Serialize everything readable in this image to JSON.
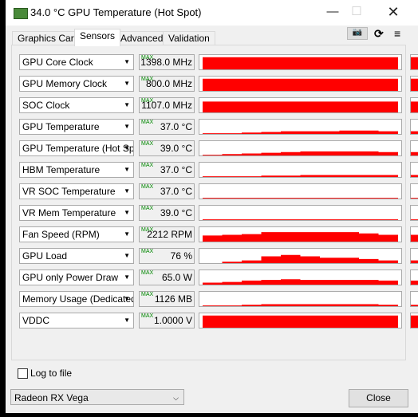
{
  "window": {
    "title": "34.0 °C GPU Temperature (Hot Spot)"
  },
  "tabs": [
    {
      "label": "Graphics Card"
    },
    {
      "label": "Sensors",
      "active": true
    },
    {
      "label": "Advanced"
    },
    {
      "label": "Validation"
    }
  ],
  "toolbar": {
    "icons": [
      "camera-icon",
      "refresh-icon",
      "menu-icon"
    ]
  },
  "graph_color": "#ff0000",
  "sensors": [
    {
      "label": "GPU Core Clock",
      "value": "1398.0 MHz",
      "max": "MAX",
      "level": [
        0.9,
        0.9,
        0.9,
        0.9,
        0.9,
        0.9,
        0.9,
        0.9,
        0.9,
        0.9
      ]
    },
    {
      "label": "GPU Memory Clock",
      "value": "800.0 MHz",
      "max": "MAX",
      "level": [
        0.9,
        0.9,
        0.9,
        0.9,
        0.9,
        0.9,
        0.9,
        0.9,
        0.9,
        0.9
      ]
    },
    {
      "label": "SOC Clock",
      "value": "1107.0 MHz",
      "max": "MAX",
      "level": [
        0.8,
        0.8,
        0.8,
        0.8,
        0.8,
        0.8,
        0.8,
        0.8,
        0.8,
        0.8
      ]
    },
    {
      "label": "GPU Temperature",
      "value": "37.0 °C",
      "max": "MAX",
      "level": [
        0.05,
        0.05,
        0.1,
        0.15,
        0.2,
        0.2,
        0.2,
        0.25,
        0.25,
        0.2
      ]
    },
    {
      "label": "GPU Temperature (Hot Spot)",
      "value": "39.0 °C",
      "max": "MAX",
      "level": [
        0.05,
        0.1,
        0.15,
        0.2,
        0.25,
        0.3,
        0.3,
        0.3,
        0.3,
        0.25
      ]
    },
    {
      "label": "HBM Temperature",
      "value": "37.0 °C",
      "max": "MAX",
      "level": [
        0.05,
        0.05,
        0.05,
        0.1,
        0.1,
        0.15,
        0.15,
        0.15,
        0.15,
        0.15
      ]
    },
    {
      "label": "VR SOC Temperature",
      "value": "37.0 °C",
      "max": "MAX",
      "level": [
        0.05,
        0.05,
        0.05,
        0.05,
        0.05,
        0.05,
        0.05,
        0.05,
        0.05,
        0.05
      ]
    },
    {
      "label": "VR Mem Temperature",
      "value": "39.0 °C",
      "max": "MAX",
      "level": [
        0.05,
        0.05,
        0.05,
        0.05,
        0.05,
        0.05,
        0.05,
        0.05,
        0.05,
        0.05
      ]
    },
    {
      "label": "Fan Speed (RPM)",
      "value": "2212 RPM",
      "max": "MAX",
      "level": [
        0.45,
        0.5,
        0.55,
        0.7,
        0.7,
        0.7,
        0.7,
        0.7,
        0.6,
        0.5
      ]
    },
    {
      "label": "GPU Load",
      "value": "76 %",
      "max": "MAX",
      "level": [
        0,
        0.1,
        0.2,
        0.5,
        0.6,
        0.5,
        0.4,
        0.4,
        0.3,
        0.2
      ]
    },
    {
      "label": "GPU only Power Draw",
      "value": "65.0 W",
      "max": "MAX",
      "level": [
        0.15,
        0.2,
        0.3,
        0.35,
        0.4,
        0.35,
        0.35,
        0.35,
        0.35,
        0.3
      ]
    },
    {
      "label": "Memory Usage (Dedicated)",
      "value": "1126 MB",
      "max": "MAX",
      "level": [
        0.05,
        0.05,
        0.1,
        0.15,
        0.15,
        0.15,
        0.15,
        0.15,
        0.15,
        0.1
      ]
    },
    {
      "label": "VDDC",
      "value": "1.0000 V",
      "max": "MAX",
      "level": [
        0.9,
        0.9,
        0.9,
        0.9,
        0.9,
        0.9,
        0.9,
        0.9,
        0.9,
        0.9
      ]
    }
  ],
  "log_to_file": {
    "label": "Log to file",
    "checked": false
  },
  "gpu_select": {
    "value": "Radeon RX Vega"
  },
  "close_label": "Close"
}
